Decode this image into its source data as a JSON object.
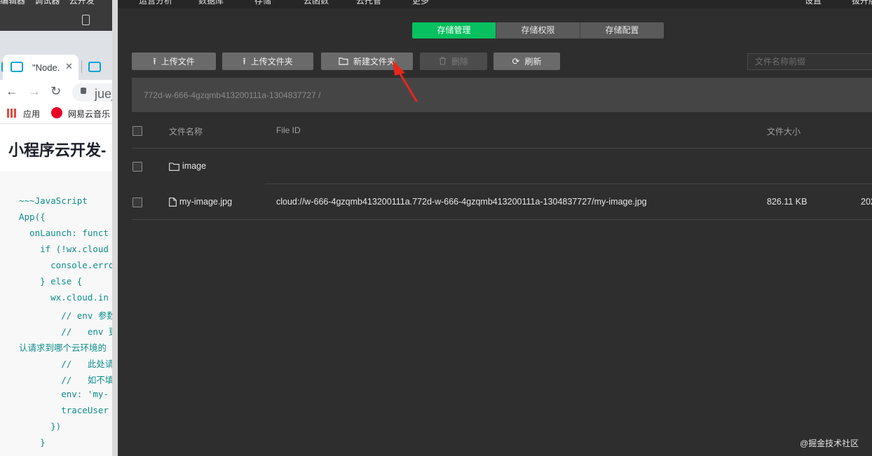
{
  "background_window": {
    "top_menu": [
      "编辑器",
      "调试器",
      "云开发"
    ],
    "tab_title": "\"Node.",
    "tab_close": "✕",
    "url_text": "juej",
    "bookmarks": {
      "apps": "应用",
      "netease": "网易云音乐"
    },
    "article_title": "小程序云开发-",
    "code_lines": [
      "~~~JavaScript",
      "App({",
      "  onLaunch: funct",
      "    if (!wx.cloud",
      "      console.erro",
      "    } else {",
      "      wx.cloud.in",
      "        // env 参数",
      "        //   env 更",
      "认请求到哪个云环境的",
      "        //   此处请",
      "        //   如不填",
      "        env: 'my-",
      "        traceUser",
      "      })",
      "    }"
    ]
  },
  "main_menu": [
    "运营分析",
    "数据库",
    "存储",
    "云函数",
    "云托管",
    "更多",
    "设置",
    "拔开版"
  ],
  "tabs": [
    {
      "label": "存储管理",
      "active": true
    },
    {
      "label": "存储权限",
      "active": false
    },
    {
      "label": "存储配置",
      "active": false
    }
  ],
  "toolbar": {
    "upload_file": "上传文件",
    "upload_folder": "上传文件夹",
    "new_folder": "新建文件夹",
    "delete": "删除",
    "refresh": "刷新"
  },
  "search": {
    "placeholder": "文件名称前缀"
  },
  "path": "772d-w-666-4gzqmb413200111a-1304837727  /",
  "table": {
    "headers": {
      "name": "文件名称",
      "file_id": "File ID",
      "size": "文件大小"
    },
    "rows": [
      {
        "type": "folder",
        "name": "image",
        "file_id": "",
        "size": "",
        "date": ""
      },
      {
        "type": "file",
        "name": "my-image.jpg",
        "file_id": "cloud://w-666-4gzqmb413200111a.772d-w-666-4gzqmb413200111a-1304837727/my-image.jpg",
        "size": "826.11 KB",
        "date": "202"
      }
    ]
  },
  "watermark": "@掘金技术社区",
  "colors": {
    "accent": "#07c160",
    "annotation_arrow": "#e8261c"
  }
}
